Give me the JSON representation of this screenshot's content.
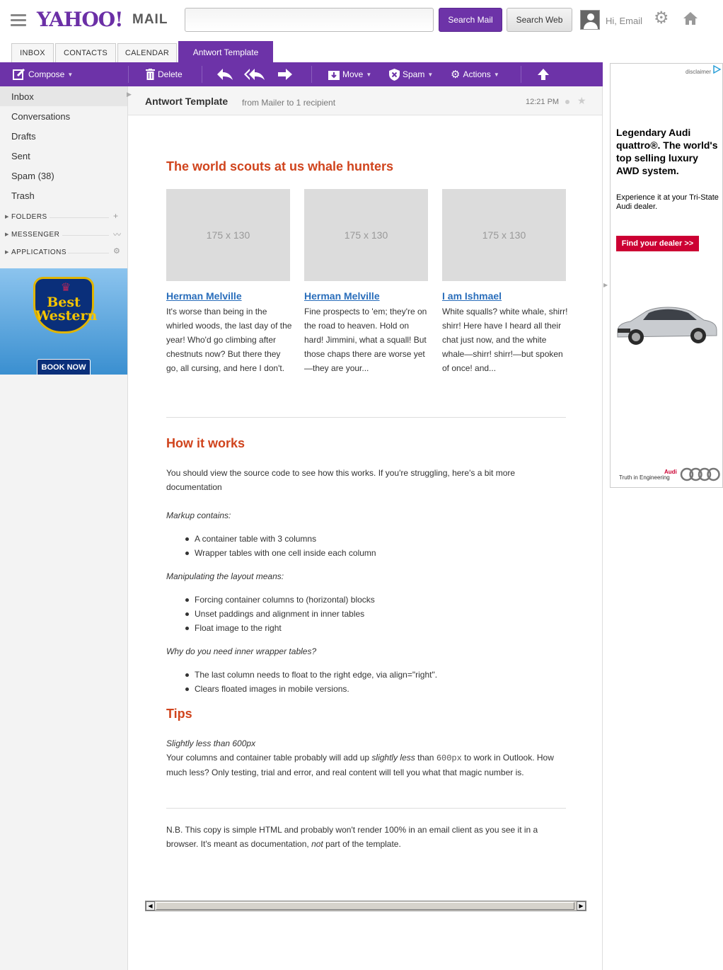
{
  "header": {
    "logo": "YAHOO!",
    "logo_suffix": "MAIL",
    "search_placeholder": "",
    "search_mail_label": "Search Mail",
    "search_web_label": "Search Web",
    "greeting": "Hi, Email"
  },
  "tabs": [
    {
      "label": "INBOX"
    },
    {
      "label": "CONTACTS"
    },
    {
      "label": "CALENDAR"
    },
    {
      "label": "Antwort Template"
    }
  ],
  "toolbar": {
    "compose": "Compose",
    "delete": "Delete",
    "move": "Move",
    "spam": "Spam",
    "actions": "Actions"
  },
  "sidebar": {
    "items": [
      {
        "label": "Inbox"
      },
      {
        "label": "Conversations"
      },
      {
        "label": "Drafts"
      },
      {
        "label": "Sent"
      },
      {
        "label": "Spam (38)"
      },
      {
        "label": "Trash"
      }
    ],
    "sections": [
      {
        "label": "FOLDERS"
      },
      {
        "label": "MESSENGER"
      },
      {
        "label": "APPLICATIONS"
      }
    ],
    "ad": {
      "brand_line1": "Best",
      "brand_line2": "Western",
      "cta": "BOOK NOW"
    }
  },
  "message": {
    "subject": "Antwort Template",
    "from": "from Mailer to 1 recipient",
    "time": "12:21 PM",
    "body": {
      "heading1": "The world scouts at us whale hunters",
      "placeholder": "175 x 130",
      "columns": [
        {
          "title": "Herman Melville",
          "text": "It's worse than being in the whirled woods, the last day of the year! Who'd go climbing after chestnuts now? But there they go, all cursing, and here I don't."
        },
        {
          "title": "Herman Melville",
          "text": "Fine prospects to 'em; they're on the road to heaven. Hold on hard! Jimmini, what a squall! But those chaps there are worse yet—they are your..."
        },
        {
          "title": "I am Ishmael",
          "text": "White squalls? white whale, shirr! shirr! Here have I heard all their chat just now, and the white whale—shirr! shirr!—but spoken of once! and..."
        }
      ],
      "heading2": "How it works",
      "intro": "You should view the source code to see how this works. If you're struggling, here's a bit more documentation",
      "markup_label": "Markup contains:",
      "markup_items": [
        "A container table with 3 columns",
        "Wrapper tables with one cell inside each column"
      ],
      "layout_label": "Manipulating the layout means:",
      "layout_items": [
        "Forcing container columns to (horizontal) blocks",
        "Unset paddings and alignment in inner tables",
        "Float image to the right"
      ],
      "why_label": "Why do you need inner wrapper tables?",
      "why_items": [
        "The last column needs to float to the right edge, via align=\"right\".",
        "Clears floated images in mobile versions."
      ],
      "heading3": "Tips",
      "tip_title": "Slightly less than 600px",
      "tip_part1": "Your columns and container table probably will add up ",
      "tip_em": "slightly less",
      "tip_part2": " than ",
      "tip_code": "600px",
      "tip_part3": " to work in Outlook. How much less? Only testing, trial and error, and real content will tell you what that magic number is.",
      "nb_part1": "N.B. This copy is simple HTML and probably won't render 100% in an email client as you see it in a browser. It's meant as documentation, ",
      "nb_em": "not",
      "nb_part2": " part of the template."
    }
  },
  "right_ad": {
    "disclaimer": "disclaimer",
    "headline": "Legendary Audi quattro®. The world's top selling luxury AWD system.",
    "subtext": "Experience it at your Tri-State Audi dealer.",
    "cta": "Find your dealer >>",
    "footer": "Truth in Engineering",
    "brand": "Audi"
  },
  "colors": {
    "accent": "#6d33a8",
    "heading": "#d0441d",
    "link": "#2a6ebb"
  }
}
